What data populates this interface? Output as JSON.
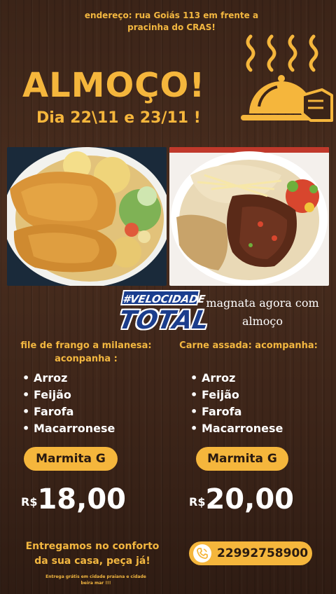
{
  "header": {
    "address": "endereço: rua Goiás 113 em frente a pracinha do CRAS!",
    "title": "ALMOÇO!",
    "date": "Dia 22\\11 e 23/11 !"
  },
  "promo": {
    "logo_top": "#VELOCIDADE",
    "logo_bottom": "TOTAL",
    "tagline": "magnata agora com almoço"
  },
  "dishes": [
    {
      "title": "file de frango a milanesa: aconpanha :",
      "items": [
        "Arroz",
        "Feijão",
        "Farofa",
        "Macarronese"
      ],
      "size": "Marmita G",
      "currency": "R$",
      "price": "18,00"
    },
    {
      "title": "Carne assada: acompanha:",
      "items": [
        "Arroz",
        "Feijão",
        "Farofa",
        "Macarronese"
      ],
      "size": "Marmita G",
      "currency": "R$",
      "price": "20,00"
    }
  ],
  "footer": {
    "delivery": "Entregamos no conforto da sua casa, peça já!",
    "fineprint": "Entrega grátis em cidade praiana e cidade beira mar !!!",
    "phone": "22992758900"
  },
  "icons": {
    "cloche": "cloche-icon",
    "phone": "phone-icon"
  },
  "colors": {
    "accent": "#f5b63c",
    "background": "#3b2418",
    "logo_blue": "#1b3d8c"
  }
}
